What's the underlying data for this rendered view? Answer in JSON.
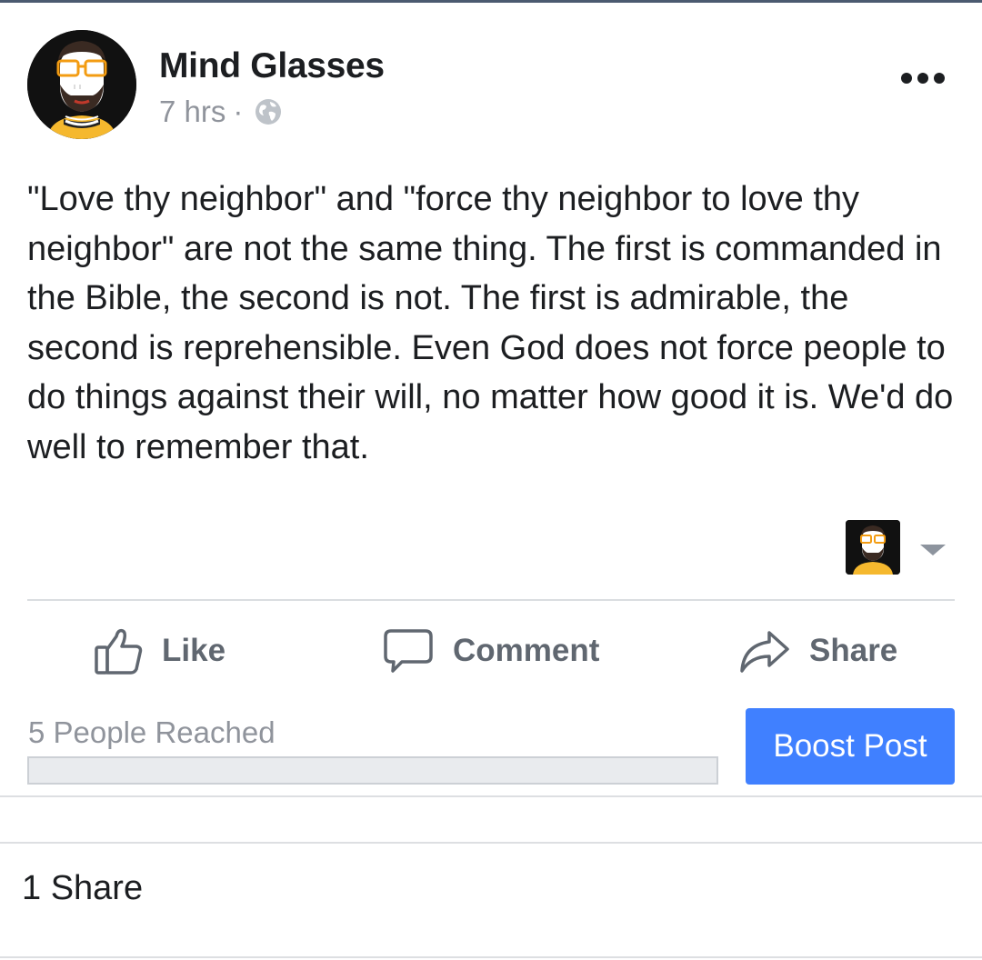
{
  "post": {
    "author_name": "Mind Glasses",
    "time": "7 hrs",
    "separator": "·",
    "privacy_icon": "globe-icon",
    "more_icon": "more-dots-icon",
    "text": "\"Love thy neighbor\" and \"force thy neighbor to love thy neighbor\" are not the same thing. The first is commanded in the Bible, the second is not. The first is admirable, the second is reprehensible. Even God does not force people to do things against their will, no matter how good it is. We'd do well to remember that."
  },
  "actions": {
    "like_label": "Like",
    "comment_label": "Comment",
    "share_label": "Share"
  },
  "insights": {
    "reach_text": "5 People Reached",
    "reach_progress": 0,
    "boost_label": "Boost Post"
  },
  "shares": {
    "count_label": "1 Share"
  },
  "colors": {
    "accent": "#4080ff",
    "text_primary": "#1c1e21",
    "text_secondary": "#90949c",
    "action_gray": "#606770",
    "divider": "#dadde1"
  }
}
